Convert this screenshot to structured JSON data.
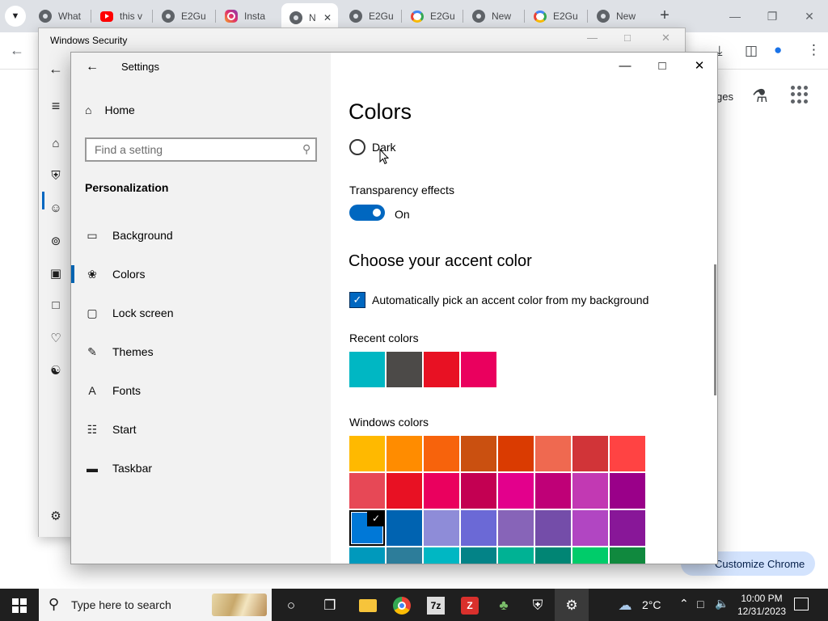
{
  "chrome": {
    "tabs": [
      {
        "label": "What",
        "favicon": "chrome"
      },
      {
        "label": "this v",
        "favicon": "youtube"
      },
      {
        "label": "E2Gu",
        "favicon": "chrome"
      },
      {
        "label": "Insta",
        "favicon": "insta"
      },
      {
        "label": "N",
        "favicon": "chrome",
        "active": true
      },
      {
        "label": "E2Gu",
        "favicon": "chrome"
      },
      {
        "label": "E2Gu",
        "favicon": "google"
      },
      {
        "label": "New",
        "favicon": "chrome"
      },
      {
        "label": "E2Gu",
        "favicon": "google"
      },
      {
        "label": "New",
        "favicon": "chrome"
      }
    ],
    "new_tab": "+",
    "images_link": "ges",
    "customize_label": "Customize Chrome"
  },
  "winsec": {
    "title": "Windows Security"
  },
  "settings": {
    "app_title": "Settings",
    "home_label": "Home",
    "search_placeholder": "Find a setting",
    "section": "Personalization",
    "nav": [
      {
        "label": "Background",
        "icon": "image-icon"
      },
      {
        "label": "Colors",
        "icon": "palette-icon",
        "selected": true
      },
      {
        "label": "Lock screen",
        "icon": "lock-screen-icon"
      },
      {
        "label": "Themes",
        "icon": "themes-icon"
      },
      {
        "label": "Fonts",
        "icon": "fonts-icon"
      },
      {
        "label": "Start",
        "icon": "start-icon"
      },
      {
        "label": "Taskbar",
        "icon": "taskbar-icon"
      }
    ],
    "page_title": "Colors",
    "mode_option": "Dark",
    "transparency_label": "Transparency effects",
    "transparency_state": "On",
    "accent_heading": "Choose your accent color",
    "auto_pick_label": "Automatically pick an accent color from my background",
    "recent_label": "Recent colors",
    "recent_colors": [
      "#00b7c3",
      "#4c4a48",
      "#e81123",
      "#ea005e"
    ],
    "windows_label": "Windows colors",
    "windows_colors": [
      "#ffb900",
      "#ff8c00",
      "#f7630c",
      "#ca5010",
      "#da3b01",
      "#ef6950",
      "#d13438",
      "#ff4343",
      "#e74856",
      "#e81123",
      "#ea005e",
      "#c30052",
      "#e3008c",
      "#bf0077",
      "#c239b3",
      "#9a0089",
      "#0078d7",
      "#0063b1",
      "#8e8cd8",
      "#6b69d6",
      "#8764b8",
      "#744da9",
      "#b146c2",
      "#881798",
      "#0099bc",
      "#2d7d9a",
      "#00b7c3",
      "#038387",
      "#00b294",
      "#018574",
      "#00cc6a",
      "#10893e"
    ],
    "selected_color_index": 16
  },
  "taskbar": {
    "search_placeholder": "Type here to search",
    "temperature": "2°C",
    "time": "10:00 PM",
    "date": "12/31/2023"
  }
}
